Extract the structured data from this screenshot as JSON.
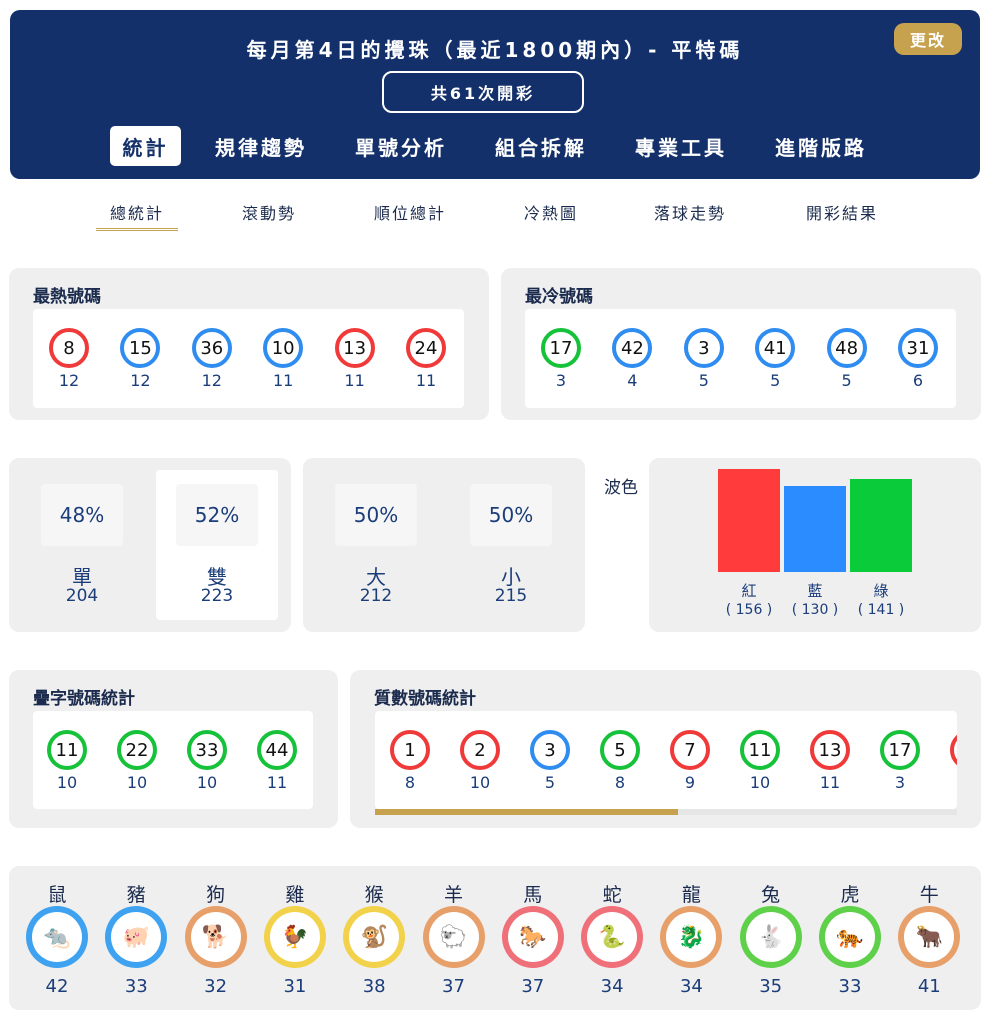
{
  "header": {
    "title": "每月第4日的攪珠（最近1800期內）- 平特碼",
    "change_label": "更改",
    "draw_count": "共61次開彩",
    "tabs": [
      "統計",
      "規律趨勢",
      "單號分析",
      "組合拆解",
      "專業工具",
      "進階版路"
    ],
    "active_tab": "統計"
  },
  "sub_tabs": {
    "items": [
      "總統計",
      "滾動勢",
      "順位總計",
      "冷熱圖",
      "落球走勢",
      "開彩結果"
    ],
    "active": "總統計"
  },
  "hot": {
    "title": "最熱號碼",
    "balls": [
      {
        "n": "8",
        "c": "12",
        "color": "red"
      },
      {
        "n": "15",
        "c": "12",
        "color": "blue"
      },
      {
        "n": "36",
        "c": "12",
        "color": "blue"
      },
      {
        "n": "10",
        "c": "11",
        "color": "blue"
      },
      {
        "n": "13",
        "c": "11",
        "color": "red"
      },
      {
        "n": "24",
        "c": "11",
        "color": "red"
      }
    ]
  },
  "cold": {
    "title": "最冷號碼",
    "balls": [
      {
        "n": "17",
        "c": "3",
        "color": "green"
      },
      {
        "n": "42",
        "c": "4",
        "color": "blue"
      },
      {
        "n": "3",
        "c": "5",
        "color": "blue"
      },
      {
        "n": "41",
        "c": "5",
        "color": "blue"
      },
      {
        "n": "48",
        "c": "5",
        "color": "blue"
      },
      {
        "n": "31",
        "c": "6",
        "color": "blue"
      }
    ]
  },
  "odd_even": {
    "odd": {
      "pct": "48%",
      "label": "單",
      "count": "204"
    },
    "even": {
      "pct": "52%",
      "label": "雙",
      "count": "223"
    }
  },
  "big_small": {
    "big": {
      "pct": "50%",
      "label": "大",
      "count": "212"
    },
    "small": {
      "pct": "50%",
      "label": "小",
      "count": "215"
    }
  },
  "wave": {
    "title": "波色",
    "colors": {
      "red": "#ff3b3b",
      "blue": "#2a8cff",
      "green": "#0acb3a"
    },
    "items": [
      {
        "label": "紅",
        "count": "( 156 )",
        "value": 156
      },
      {
        "label": "藍",
        "count": "( 130 )",
        "value": 130
      },
      {
        "label": "綠",
        "count": "( 141 )",
        "value": 141
      }
    ]
  },
  "repeat": {
    "title": "疊字號碼統計",
    "balls": [
      {
        "n": "11",
        "c": "10",
        "color": "green"
      },
      {
        "n": "22",
        "c": "10",
        "color": "green"
      },
      {
        "n": "33",
        "c": "10",
        "color": "green"
      },
      {
        "n": "44",
        "c": "11",
        "color": "green"
      }
    ]
  },
  "prime": {
    "title": "質數號碼統計",
    "balls": [
      {
        "n": "1",
        "c": "8",
        "color": "red"
      },
      {
        "n": "2",
        "c": "10",
        "color": "red"
      },
      {
        "n": "3",
        "c": "5",
        "color": "blue"
      },
      {
        "n": "5",
        "c": "8",
        "color": "green"
      },
      {
        "n": "7",
        "c": "9",
        "color": "red"
      },
      {
        "n": "11",
        "c": "10",
        "color": "green"
      },
      {
        "n": "13",
        "c": "11",
        "color": "red"
      },
      {
        "n": "17",
        "c": "3",
        "color": "green"
      }
    ],
    "scroll_fraction": 0.52
  },
  "zodiac": {
    "items": [
      {
        "name": "鼠",
        "count": "42",
        "glyph": "🐀",
        "ring": "#3ea2f0",
        "icon": "rat-icon"
      },
      {
        "name": "豬",
        "count": "33",
        "glyph": "🐖",
        "ring": "#3ea2f0",
        "icon": "pig-icon"
      },
      {
        "name": "狗",
        "count": "32",
        "glyph": "🐕",
        "ring": "#e8a06a",
        "icon": "dog-icon"
      },
      {
        "name": "雞",
        "count": "31",
        "glyph": "🐓",
        "ring": "#f2d24a",
        "icon": "rooster-icon"
      },
      {
        "name": "猴",
        "count": "38",
        "glyph": "🐒",
        "ring": "#f2d24a",
        "icon": "monkey-icon"
      },
      {
        "name": "羊",
        "count": "37",
        "glyph": "🐑",
        "ring": "#e8a06a",
        "icon": "goat-icon"
      },
      {
        "name": "馬",
        "count": "37",
        "glyph": "🐎",
        "ring": "#f0707a",
        "icon": "horse-icon"
      },
      {
        "name": "蛇",
        "count": "34",
        "glyph": "🐍",
        "ring": "#f0707a",
        "icon": "snake-icon"
      },
      {
        "name": "龍",
        "count": "34",
        "glyph": "🐉",
        "ring": "#e8a06a",
        "icon": "dragon-icon"
      },
      {
        "name": "兔",
        "count": "35",
        "glyph": "🐇",
        "ring": "#5fd04a",
        "icon": "rabbit-icon"
      },
      {
        "name": "虎",
        "count": "33",
        "glyph": "🐅",
        "ring": "#5fd04a",
        "icon": "tiger-icon"
      },
      {
        "name": "牛",
        "count": "41",
        "glyph": "🐂",
        "ring": "#e8a06a",
        "icon": "ox-icon"
      }
    ]
  }
}
